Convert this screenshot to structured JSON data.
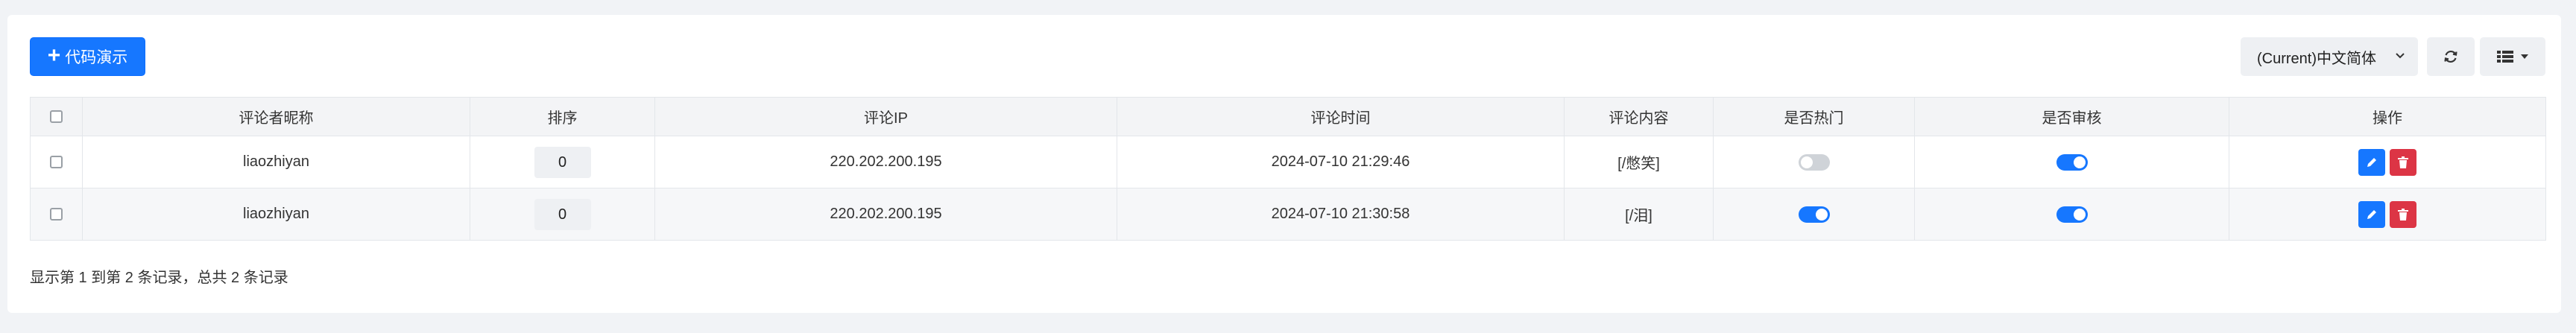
{
  "toolbar": {
    "demo_button": "代码演示",
    "language": "(Current)中文简体"
  },
  "table": {
    "headers": [
      "评论者昵称",
      "排序",
      "评论IP",
      "评论时间",
      "评论内容",
      "是否热门",
      "是否审核",
      "操作"
    ],
    "rows": [
      {
        "nickname": "liaozhiyan",
        "sort": "0",
        "ip": "220.202.200.195",
        "time": "2024-07-10 21:29:46",
        "content": "[/憋笑]",
        "hot": false,
        "approved": true
      },
      {
        "nickname": "liaozhiyan",
        "sort": "0",
        "ip": "220.202.200.195",
        "time": "2024-07-10 21:30:58",
        "content": "[/泪]",
        "hot": true,
        "approved": true
      }
    ]
  },
  "pagination": {
    "summary": "显示第 1 到第 2 条记录，总共 2 条记录"
  },
  "colors": {
    "primary": "#1677ff",
    "danger": "#dc3545",
    "toggle_off": "#cfd3d8"
  }
}
